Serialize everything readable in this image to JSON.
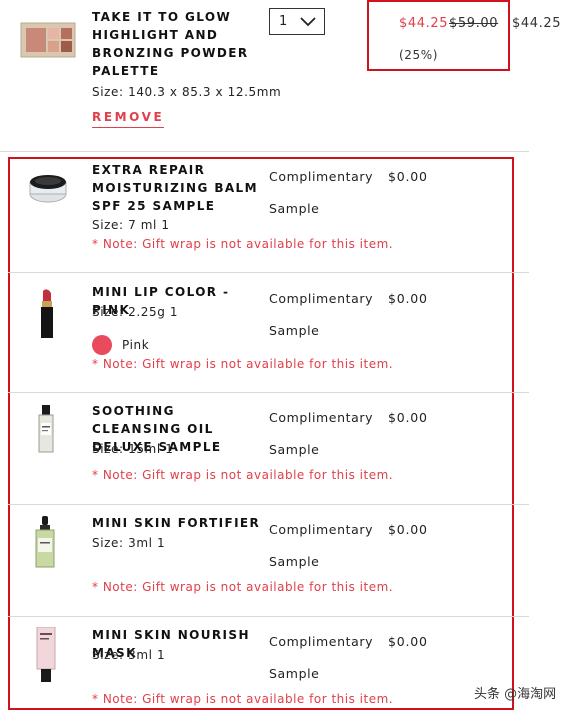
{
  "colors": {
    "accent_red": "#e0404b",
    "highlight_box": "#d0121e",
    "divider": "#d9d9d9"
  },
  "main_item": {
    "title": "TAKE IT TO GLOW HIGHLIGHT AND BRONZING POWDER PALETTE",
    "size": "Size: 140.3 x 85.3 x 12.5mm",
    "remove_label": "REMOVE",
    "quantity": "1",
    "sale_price": "$44.25",
    "original_price": "$59.00",
    "discount": "(25%)",
    "total": "$44.25",
    "icon": "palette-image"
  },
  "samples": [
    {
      "title": "EXTRA REPAIR MOISTURIZING BALM SPF 25 SAMPLE",
      "size": "Size: 7 ml 1",
      "comp_line1": "Complimentary",
      "comp_line2": "Sample",
      "price": "$0.00",
      "note": "* Note: Gift wrap is not available for this item."
    },
    {
      "title": "MINI LIP COLOR - PINK",
      "size": "Size: 2.25g 1",
      "shade": "Pink",
      "shade_color": "#e94a5e",
      "comp_line1": "Complimentary",
      "comp_line2": "Sample",
      "price": "$0.00",
      "note": "* Note: Gift wrap is not available for this item."
    },
    {
      "title": "SOOTHING CLEANSING OIL DELUXE SAMPLE",
      "size": "Size: 15ml 1",
      "comp_line1": "Complimentary",
      "comp_line2": "Sample",
      "price": "$0.00",
      "note": "* Note: Gift wrap is not available for this item."
    },
    {
      "title": "MINI SKIN FORTIFIER",
      "size": "Size: 3ml 1",
      "comp_line1": "Complimentary",
      "comp_line2": "Sample",
      "price": "$0.00",
      "note": "* Note: Gift wrap is not available for this item."
    },
    {
      "title": "MINI SKIN NOURISH MASK",
      "size": "Size: 3ml 1",
      "comp_line1": "Complimentary",
      "comp_line2": "Sample",
      "price": "$0.00",
      "note": "* Note: Gift wrap is not available for this item."
    }
  ],
  "watermark": "头条 @海淘网"
}
